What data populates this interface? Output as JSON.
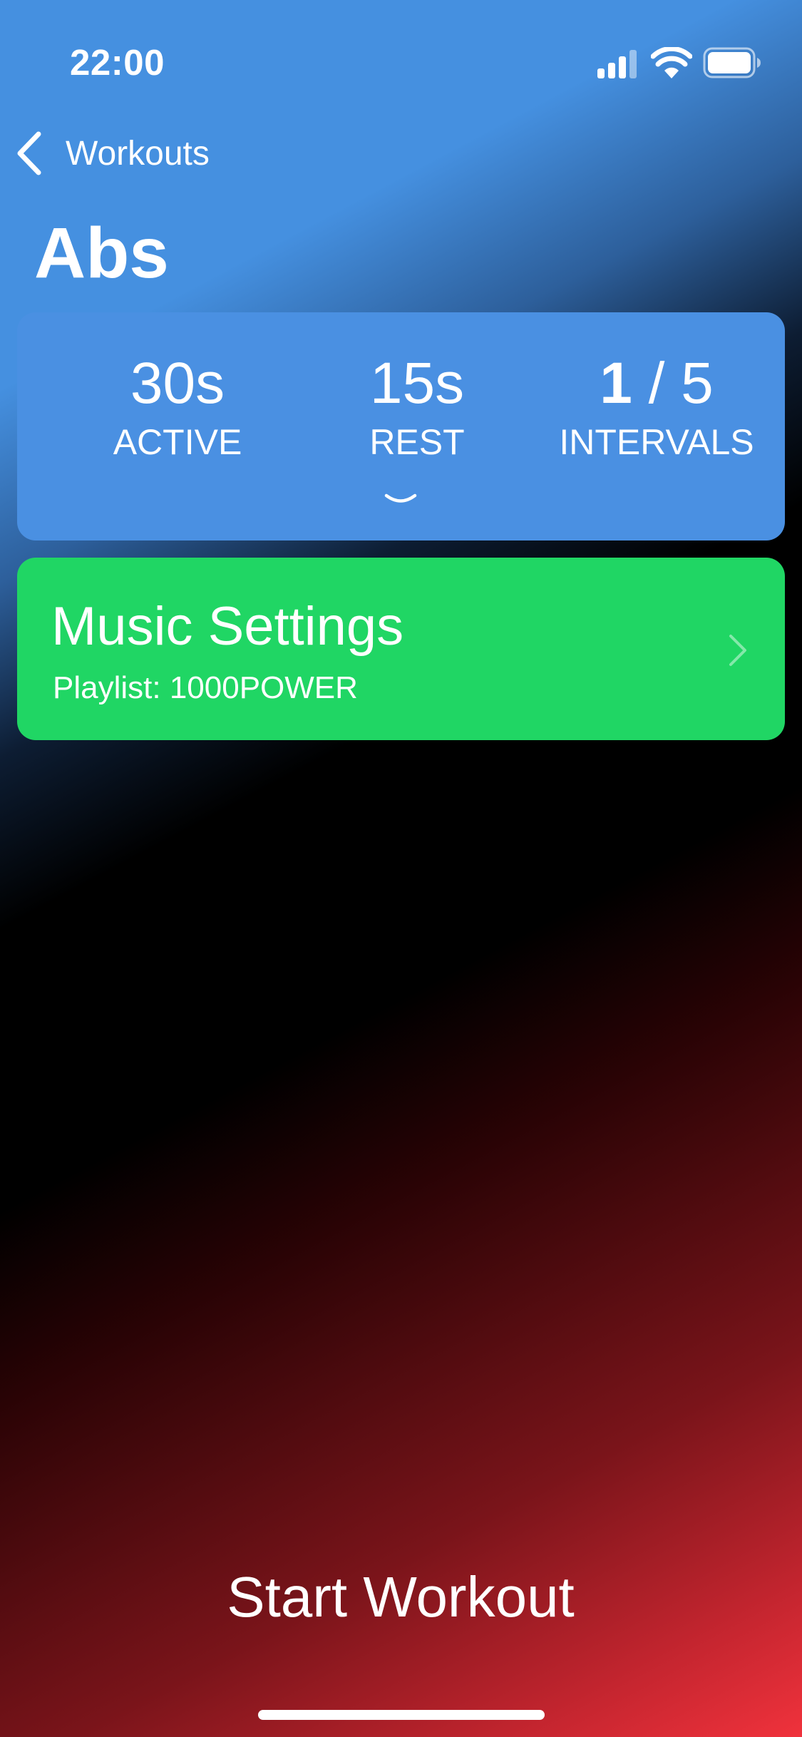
{
  "status_bar": {
    "time": "22:00",
    "icons": [
      "signal-icon",
      "wifi-icon",
      "battery-icon"
    ]
  },
  "nav": {
    "back_label": "Workouts",
    "back_icon": "chevron-left-icon"
  },
  "page": {
    "title": "Abs"
  },
  "stats": {
    "active_value": "30s",
    "active_label": "ACTIVE",
    "rest_value": "15s",
    "rest_label": "REST",
    "intervals_current": "1",
    "intervals_separator": " / ",
    "intervals_total": "5",
    "intervals_label": "INTERVALS",
    "expand_icon": "chevron-down-icon"
  },
  "music": {
    "title": "Music Settings",
    "subtitle": "Playlist: 1000POWER",
    "icon": "chevron-right-icon"
  },
  "actions": {
    "start_label": "Start Workout"
  },
  "colors": {
    "accent_blue": "#4a90e2",
    "music_green": "#20d664",
    "gradient_red": "#f0323c",
    "text": "#ffffff"
  }
}
